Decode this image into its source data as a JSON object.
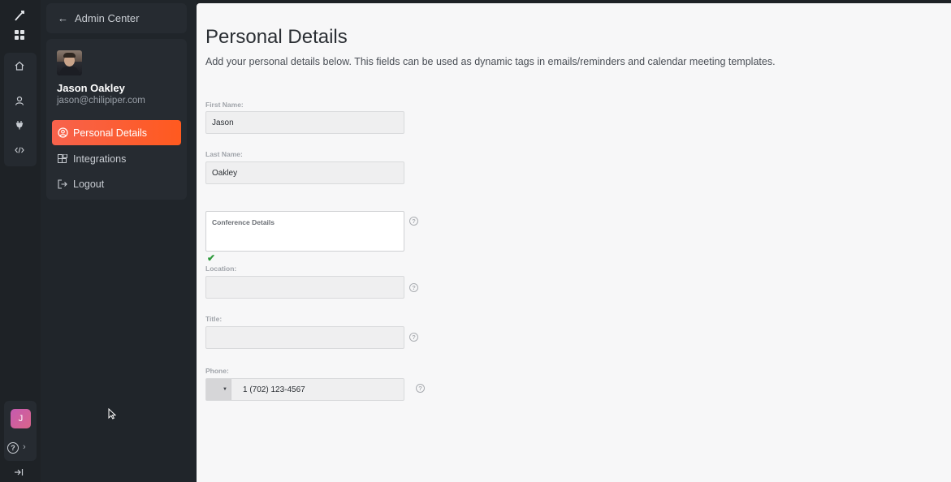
{
  "sidebar": {
    "back_label": "Admin Center",
    "back_arrow": "←",
    "user_name": "Jason Oakley",
    "user_email": "jason@chilipiper.com",
    "items": [
      {
        "label": "Personal Details",
        "icon": "user-circle-icon",
        "active": true
      },
      {
        "label": "Integrations",
        "icon": "grid-icon",
        "active": false
      },
      {
        "label": "Logout",
        "icon": "logout-icon",
        "active": false
      }
    ]
  },
  "rail": {
    "avatar_initial": "J",
    "icons": [
      "chilipiper-logo-icon",
      "apps-grid-icon",
      "home-icon",
      "user-icon",
      "plug-icon",
      "code-icon"
    ],
    "help_glyph": "?",
    "help_chevron": "›",
    "collapse_glyph": "→|"
  },
  "main": {
    "title": "Personal Details",
    "description": "Add your personal details below. This fields can be used as dynamic tags in emails/reminders and calendar meeting templates.",
    "first_name_label": "First Name:",
    "first_name_value": "Jason",
    "last_name_label": "Last Name:",
    "last_name_value": "Oakley",
    "conference_placeholder": "Conference Details",
    "check_glyph": "✔",
    "location_label": "Location:",
    "location_value": "",
    "title_label": "Title:",
    "title_value": "",
    "phone_label": "Phone:",
    "phone_dropdown_glyph": "▼",
    "phone_value": "1 (702) 123-4567",
    "help_glyph": "?"
  },
  "colors": {
    "accent": "#ff5a1f",
    "sidebar_bg": "#20252a",
    "main_bg": "#f7f7f8",
    "check": "#2e9a3c"
  }
}
